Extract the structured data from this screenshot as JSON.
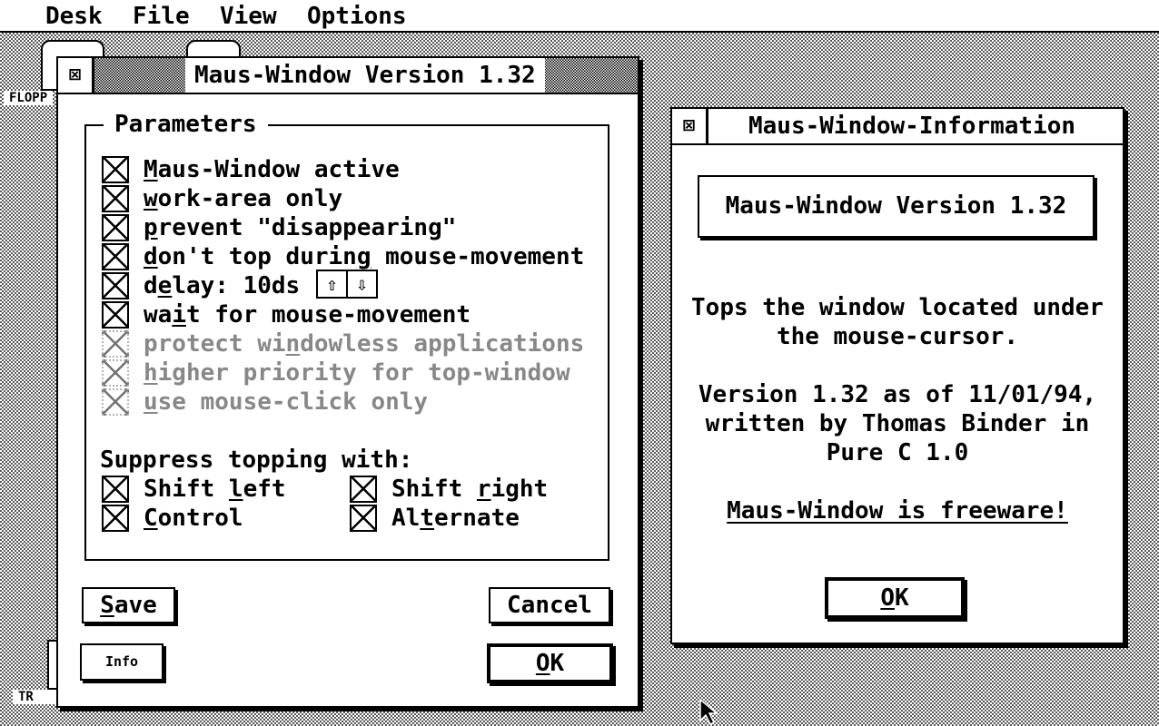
{
  "menu": [
    "Desk",
    "File",
    "View",
    "Options"
  ],
  "desktop_icons": {
    "floppy_label": "FLOPP",
    "trash_label": "TR"
  },
  "main_window": {
    "title": "Maus-Window Version 1.32",
    "group_title": "Parameters",
    "options": [
      {
        "pre": "",
        "key": "M",
        "post": "aus-Window active",
        "checked": true,
        "enabled": true
      },
      {
        "pre": "",
        "key": "w",
        "post": "ork-area only",
        "checked": true,
        "enabled": true
      },
      {
        "pre": "",
        "key": "p",
        "post": "revent \"disappearing\"",
        "checked": true,
        "enabled": true
      },
      {
        "pre": "",
        "key": "d",
        "post": "on't top durin",
        "key2": "g",
        "post2": " mouse-movement",
        "checked": true,
        "enabled": true
      },
      {
        "pre": "d",
        "key": "e",
        "post": "lay: 10ds",
        "checked": true,
        "enabled": true
      },
      {
        "pre": "wa",
        "key": "i",
        "post": "t for mouse-movement",
        "checked": true,
        "enabled": true
      },
      {
        "pre": "protect wi",
        "key": "n",
        "post": "dowless applications",
        "checked": true,
        "enabled": false
      },
      {
        "pre": "",
        "key": "h",
        "post": "igher priority for top-window",
        "checked": true,
        "enabled": false
      },
      {
        "pre": "",
        "key": "u",
        "post": "se mouse-click only",
        "checked": true,
        "enabled": false
      }
    ],
    "delay_up": "⇧",
    "delay_down": "⇩",
    "suppress_label": "Suppress topping with:",
    "suppress": [
      {
        "pre": "Shift ",
        "key": "l",
        "post": "eft",
        "checked": true
      },
      {
        "pre": "Shift ",
        "key": "r",
        "post": "ight",
        "checked": true
      },
      {
        "pre": "",
        "key": "C",
        "post": "ontrol",
        "checked": true
      },
      {
        "pre": "Al",
        "key": "t",
        "post": "ernate",
        "checked": true
      }
    ],
    "save": {
      "key": "S",
      "post": "ave"
    },
    "cancel": "Cancel",
    "info": "Info",
    "ok": {
      "key": "O",
      "post": "K"
    }
  },
  "info_window": {
    "title": "Maus-Window-Information",
    "version_box": "Maus-Window Version 1.32",
    "desc1": "Tops the window located under",
    "desc2": "the mouse-cursor.",
    "ver1": "Version 1.32 as of 11/01/94,",
    "ver2": "written by Thomas Binder in",
    "ver3": "Pure C 1.0",
    "freeware": "Maus-Window is freeware!",
    "ok": {
      "key": "O",
      "post": "K"
    }
  }
}
